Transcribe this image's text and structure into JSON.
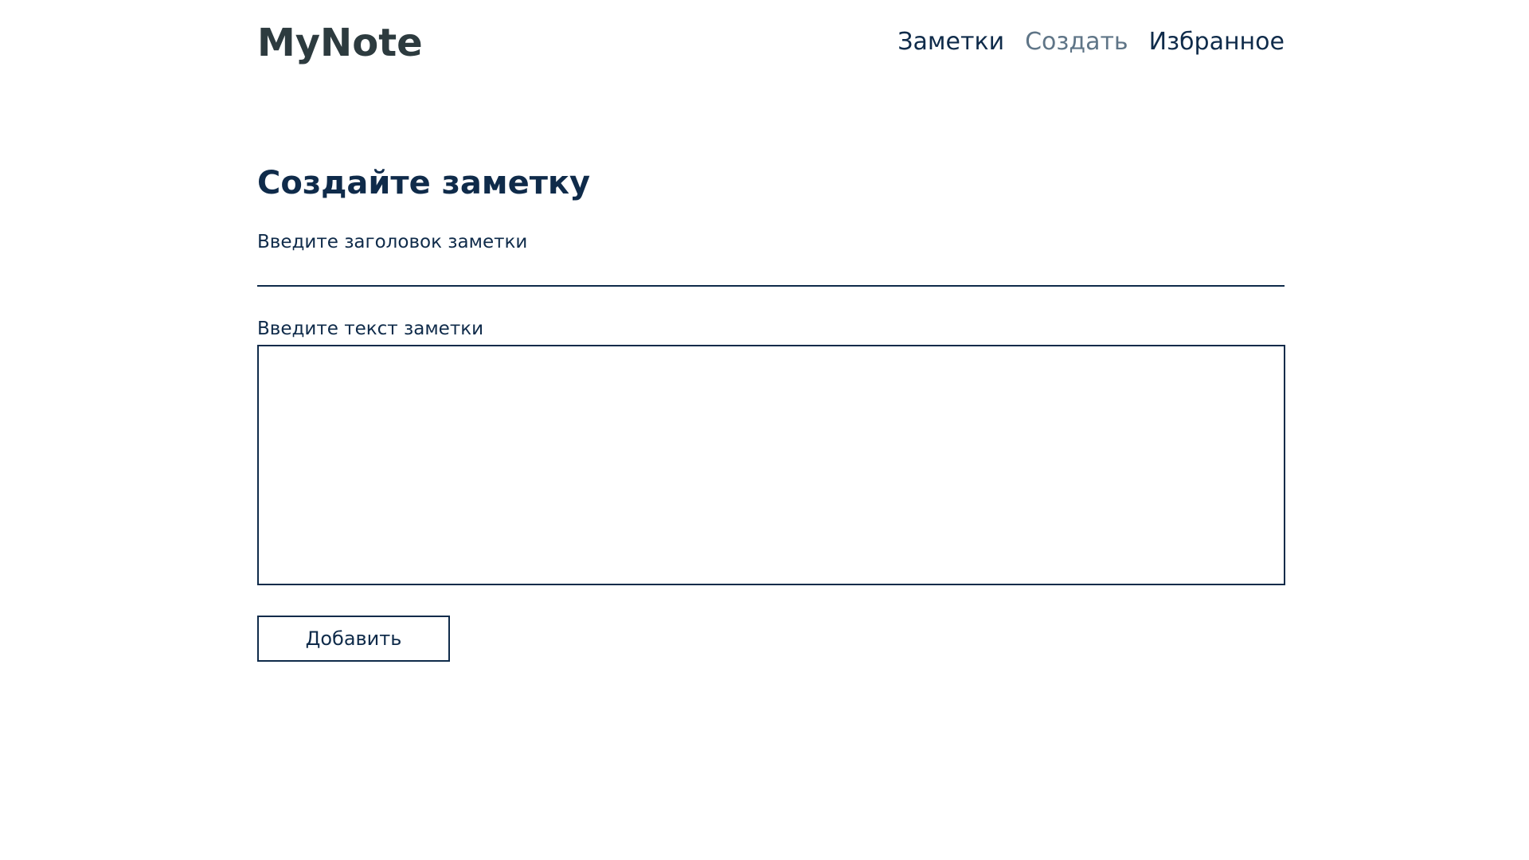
{
  "header": {
    "logo": "MyNote",
    "nav": [
      {
        "label": "Заметки",
        "active": false
      },
      {
        "label": "Создать",
        "active": true
      },
      {
        "label": "Избранное",
        "active": false
      }
    ]
  },
  "form": {
    "heading": "Создайте заметку",
    "title_label": "Введите заголовок заметки",
    "title_value": "",
    "text_label": "Введите текст заметки",
    "text_value": "",
    "submit_label": "Добавить"
  },
  "colors": {
    "primary": "#0f2b4a",
    "logo": "#2d3b3f",
    "nav_active": "#5f7587",
    "background": "#ffffff"
  }
}
